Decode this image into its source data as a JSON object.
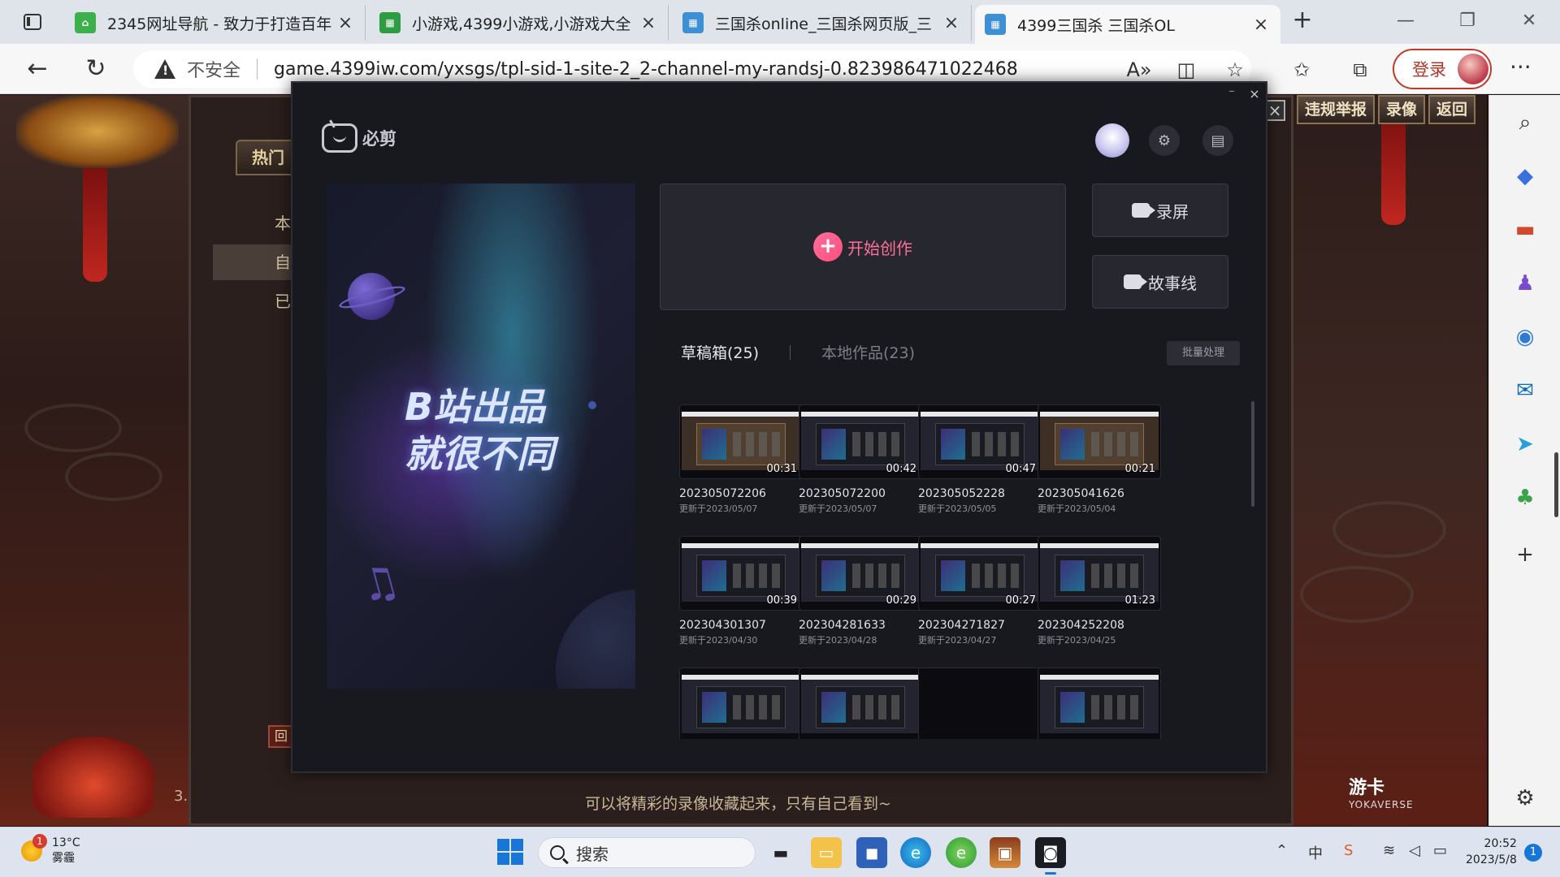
{
  "browser": {
    "tabs": [
      {
        "title": "2345网址导航 - 致力于打造百年",
        "favicon": "2345-house-icon"
      },
      {
        "title": "小游戏,4399小游戏,小游戏大全",
        "favicon": "4399-grid-icon"
      },
      {
        "title": "三国杀online_三国杀网页版_三",
        "favicon": "sgs-grid-icon"
      },
      {
        "title": "4399三国杀 三国杀OL",
        "favicon": "sgs-grid-icon"
      }
    ],
    "security_label": "不安全",
    "url": "game.4399iw.com/yxsgs/tpl-sid-1-site-2_2-channel-my-randsj-0.823986471022468",
    "login_label": "登录"
  },
  "game": {
    "hot_tab": "热门",
    "side_items": [
      "本",
      "自",
      "已"
    ],
    "top_buttons": [
      "违规举报",
      "录像",
      "返回"
    ],
    "back_btn": "回",
    "page_num": "3.",
    "note": "可以将精彩的录像收藏起来，只有自己看到~",
    "brand": "游卡",
    "brand_sub": "YOKAVERSE"
  },
  "app": {
    "name": "必剪",
    "slogan_line1": "B站出品",
    "slogan_line2": "就很不同",
    "create_label": "开始创作",
    "record_label": "录屏",
    "story_label": "故事线",
    "tab_drafts": "草稿箱(25)",
    "tab_local": "本地作品(23)",
    "batch_label": "批量处理",
    "drafts": [
      {
        "name": "202305072206",
        "updated": "更新于2023/05/07",
        "duration": "00:31",
        "kind": "game"
      },
      {
        "name": "202305072200",
        "updated": "更新于2023/05/07",
        "duration": "00:42",
        "kind": "app"
      },
      {
        "name": "202305052228",
        "updated": "更新于2023/05/05",
        "duration": "00:47",
        "kind": "app"
      },
      {
        "name": "202305041626",
        "updated": "更新于2023/05/04",
        "duration": "00:21",
        "kind": "game"
      },
      {
        "name": "202304301307",
        "updated": "更新于2023/04/30",
        "duration": "00:39",
        "kind": "app"
      },
      {
        "name": "202304281633",
        "updated": "更新于2023/04/28",
        "duration": "00:29",
        "kind": "app"
      },
      {
        "name": "202304271827",
        "updated": "更新于2023/04/27",
        "duration": "00:27",
        "kind": "app"
      },
      {
        "name": "202304252208",
        "updated": "更新于2023/04/25",
        "duration": "01:23",
        "kind": "app"
      },
      {
        "name": "",
        "updated": "",
        "duration": "",
        "kind": "app"
      },
      {
        "name": "",
        "updated": "",
        "duration": "",
        "kind": "app"
      },
      {
        "name": "",
        "updated": "",
        "duration": "",
        "kind": "blank"
      },
      {
        "name": "",
        "updated": "",
        "duration": "",
        "kind": "app"
      }
    ]
  },
  "taskbar": {
    "temp": "13°C",
    "weather": "雾霾",
    "weather_badge": "1",
    "search_placeholder": "搜索",
    "time": "20:52",
    "date": "2023/5/8",
    "notif_count": "1"
  },
  "colors": {
    "accent_pink": "#ff6e9c",
    "app_bg": "#18191f",
    "login_red": "#c0392b",
    "win_blue": "#1877d6"
  }
}
